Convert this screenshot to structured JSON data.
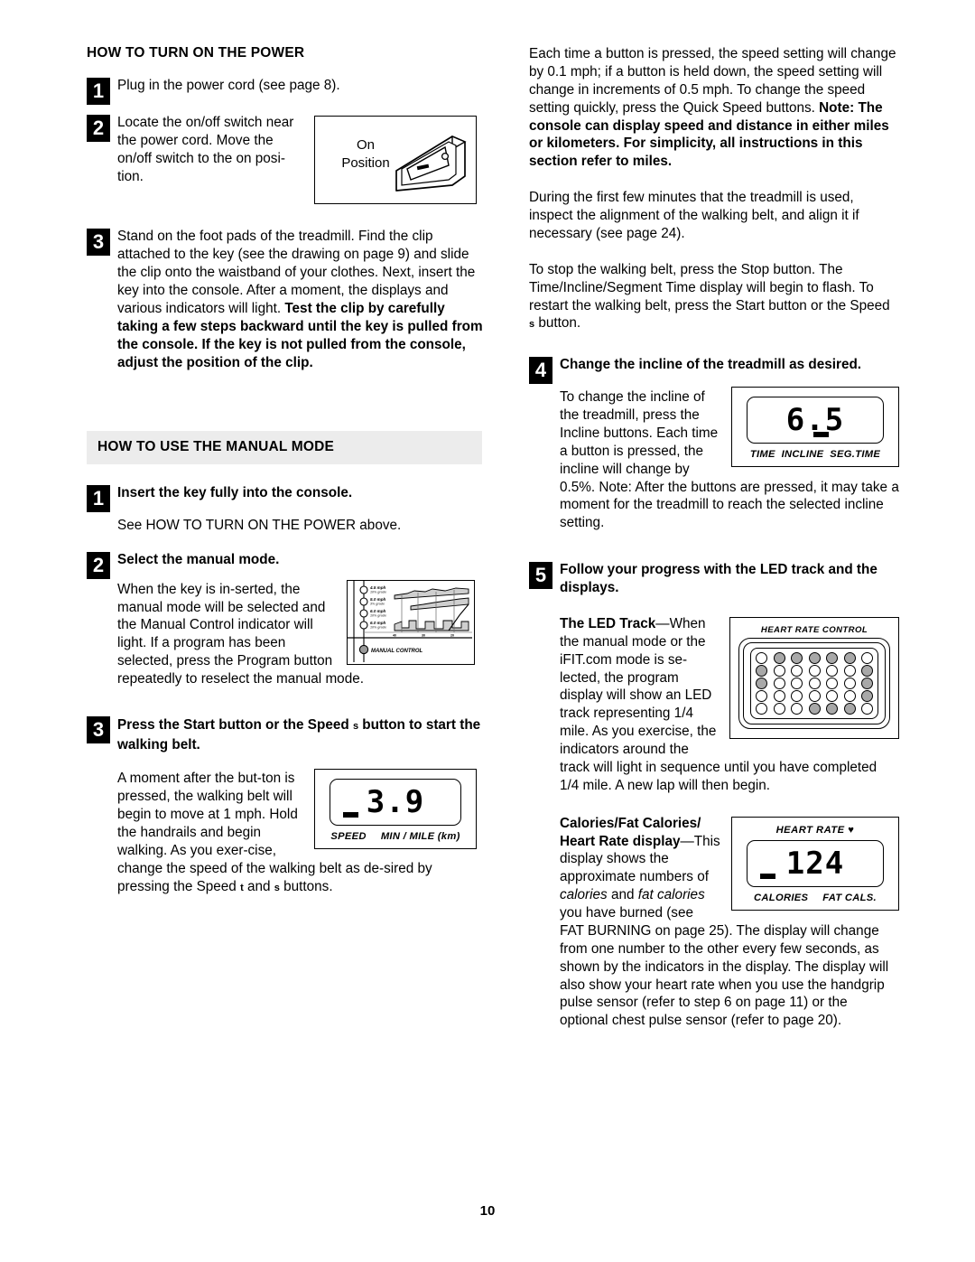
{
  "page": {
    "number": "10"
  },
  "left_column": {
    "section1": {
      "title": "HOW TO TURN ON THE POWER",
      "steps": [
        {
          "num": "1",
          "text": "Plug in the power cord (see page 8)."
        },
        {
          "num": "2",
          "text": "Locate the on/off switch near the power cord. Move the on/off switch to the on posi-tion.",
          "figure": {
            "line1": "On",
            "line2": "Position"
          }
        },
        {
          "num": "3",
          "text_plain": "Stand on the foot pads of the treadmill. Find the clip attached to the key (see the drawing on page 9) and slide the clip onto the waistband of your clothes. Next, insert the key into the console. After a moment, the displays and various indicators will light. ",
          "text_bold": "Test the clip by carefully taking a few steps backward until the key is pulled from the console. If the key is not pulled from the console, adjust the position of the clip."
        }
      ]
    },
    "section2": {
      "title": "HOW TO USE THE MANUAL MODE",
      "step1": {
        "num": "1",
        "heading": "Insert the key fully into the console.",
        "body": "See HOW TO TURN ON THE POWER above."
      },
      "step2": {
        "num": "2",
        "heading": "Select the manual mode.",
        "body": "When the key is in-serted, the manual mode will be selected and the Manual Control indicator will light. If a program has been selected, press the Program button repeatedly to reselect the manual mode.",
        "figure": {
          "rows": [
            {
              "speed": "4.5 mph",
              "grade": "10% grade"
            },
            {
              "speed": "5.0 mph",
              "grade": "3% grade"
            },
            {
              "speed": "6.0 mph",
              "grade": "10% grade"
            },
            {
              "speed": "6.0 mph",
              "grade": "10% grade"
            }
          ],
          "axis": [
            "40",
            "30",
            "20"
          ],
          "indicator_label": "MANUAL CONTROL"
        }
      },
      "step3": {
        "num": "3",
        "heading_part1": "Press the Start button or the Speed ",
        "heading_symbol": "s",
        "heading_part2": " button to start the walking belt.",
        "body": "A moment after the but-ton is pressed, the walking belt will begin to move at 1 mph. Hold the handrails and begin walking. As you exer-cise, change the speed of the walking belt as de-sired by pressing the Speed ",
        "body_sym1": "t",
        "body_mid": " and ",
        "body_sym2": "s",
        "body_end": " buttons.",
        "figure": {
          "digits": "3.9",
          "caption_left": "SPEED",
          "caption_right": "MIN / MILE (km)"
        }
      }
    }
  },
  "right_column": {
    "para1_plain": "Each time a button is pressed, the speed setting will change by 0.1 mph; if a button is held down, the speed setting will change in increments of 0.5 mph. To change the speed setting quickly, press the Quick Speed buttons. ",
    "para1_bold": "Note: The console can display speed and distance in either miles or kilometers. For simplicity, all instructions in this section refer to miles.",
    "para2": "During the first few minutes that the treadmill is used, inspect the alignment of the walking belt, and align it if necessary (see page 24).",
    "para3_a": "To stop the walking belt, press the Stop button. The Time/Incline/Segment Time display will begin to flash. To restart the walking belt, press the Start button or the Speed ",
    "para3_sym": "s",
    "para3_b": " button.",
    "step4": {
      "num": "4",
      "heading": "Change the incline of the treadmill as desired.",
      "body": "To change the incline of the treadmill, press the Incline buttons. Each time a button is pressed, the incline will change by 0.5%. Note: After the buttons are pressed, it may take a moment for the treadmill to reach the selected incline setting.",
      "figure": {
        "digits": "6.5",
        "caption": "TIME  INCLINE  SEG.TIME"
      }
    },
    "step5": {
      "num": "5",
      "heading": "Follow your progress with the LED track and the displays.",
      "led_block": {
        "bold_lead": "The LED Track",
        "dash": "—",
        "body": "When the manual mode or the iFIT.com mode is se-lected, the program display will show an LED track representing 1/4 mile. As you exercise, the indicators around the track will light in sequence until you have completed 1/4 mile. A new lap will then begin.",
        "figure": {
          "title": "HEART RATE CONTROL",
          "grid": [
            [
              0,
              1,
              1,
              1,
              1,
              1,
              0
            ],
            [
              1,
              0,
              0,
              0,
              0,
              0,
              1
            ],
            [
              1,
              0,
              0,
              0,
              0,
              0,
              1
            ],
            [
              0,
              0,
              0,
              0,
              0,
              0,
              1
            ],
            [
              0,
              0,
              0,
              1,
              1,
              1,
              0
            ]
          ]
        }
      },
      "cal_block": {
        "bold_lead1": "Calories/Fat Calories/",
        "bold_lead2": "Heart Rate display",
        "dash": "—",
        "body_a": "This display shows the approximate numbers of ",
        "italic_a": "calories",
        "body_b": " and ",
        "italic_b": "fat calories",
        "body_c": " you have burned (see FAT BURNING on page 25). The display will change from one number to the other every few seconds, as shown by the indicators in the display. The display will also show your heart rate when you use the handgrip pulse sensor (refer to step 6 on page 11) or the optional chest pulse sensor (refer to page 20).",
        "figure": {
          "top_label": "HEART RATE",
          "heart": "♥",
          "digits": "124",
          "caption_left": "CALORIES",
          "caption_right": "FAT CALS."
        }
      }
    }
  }
}
